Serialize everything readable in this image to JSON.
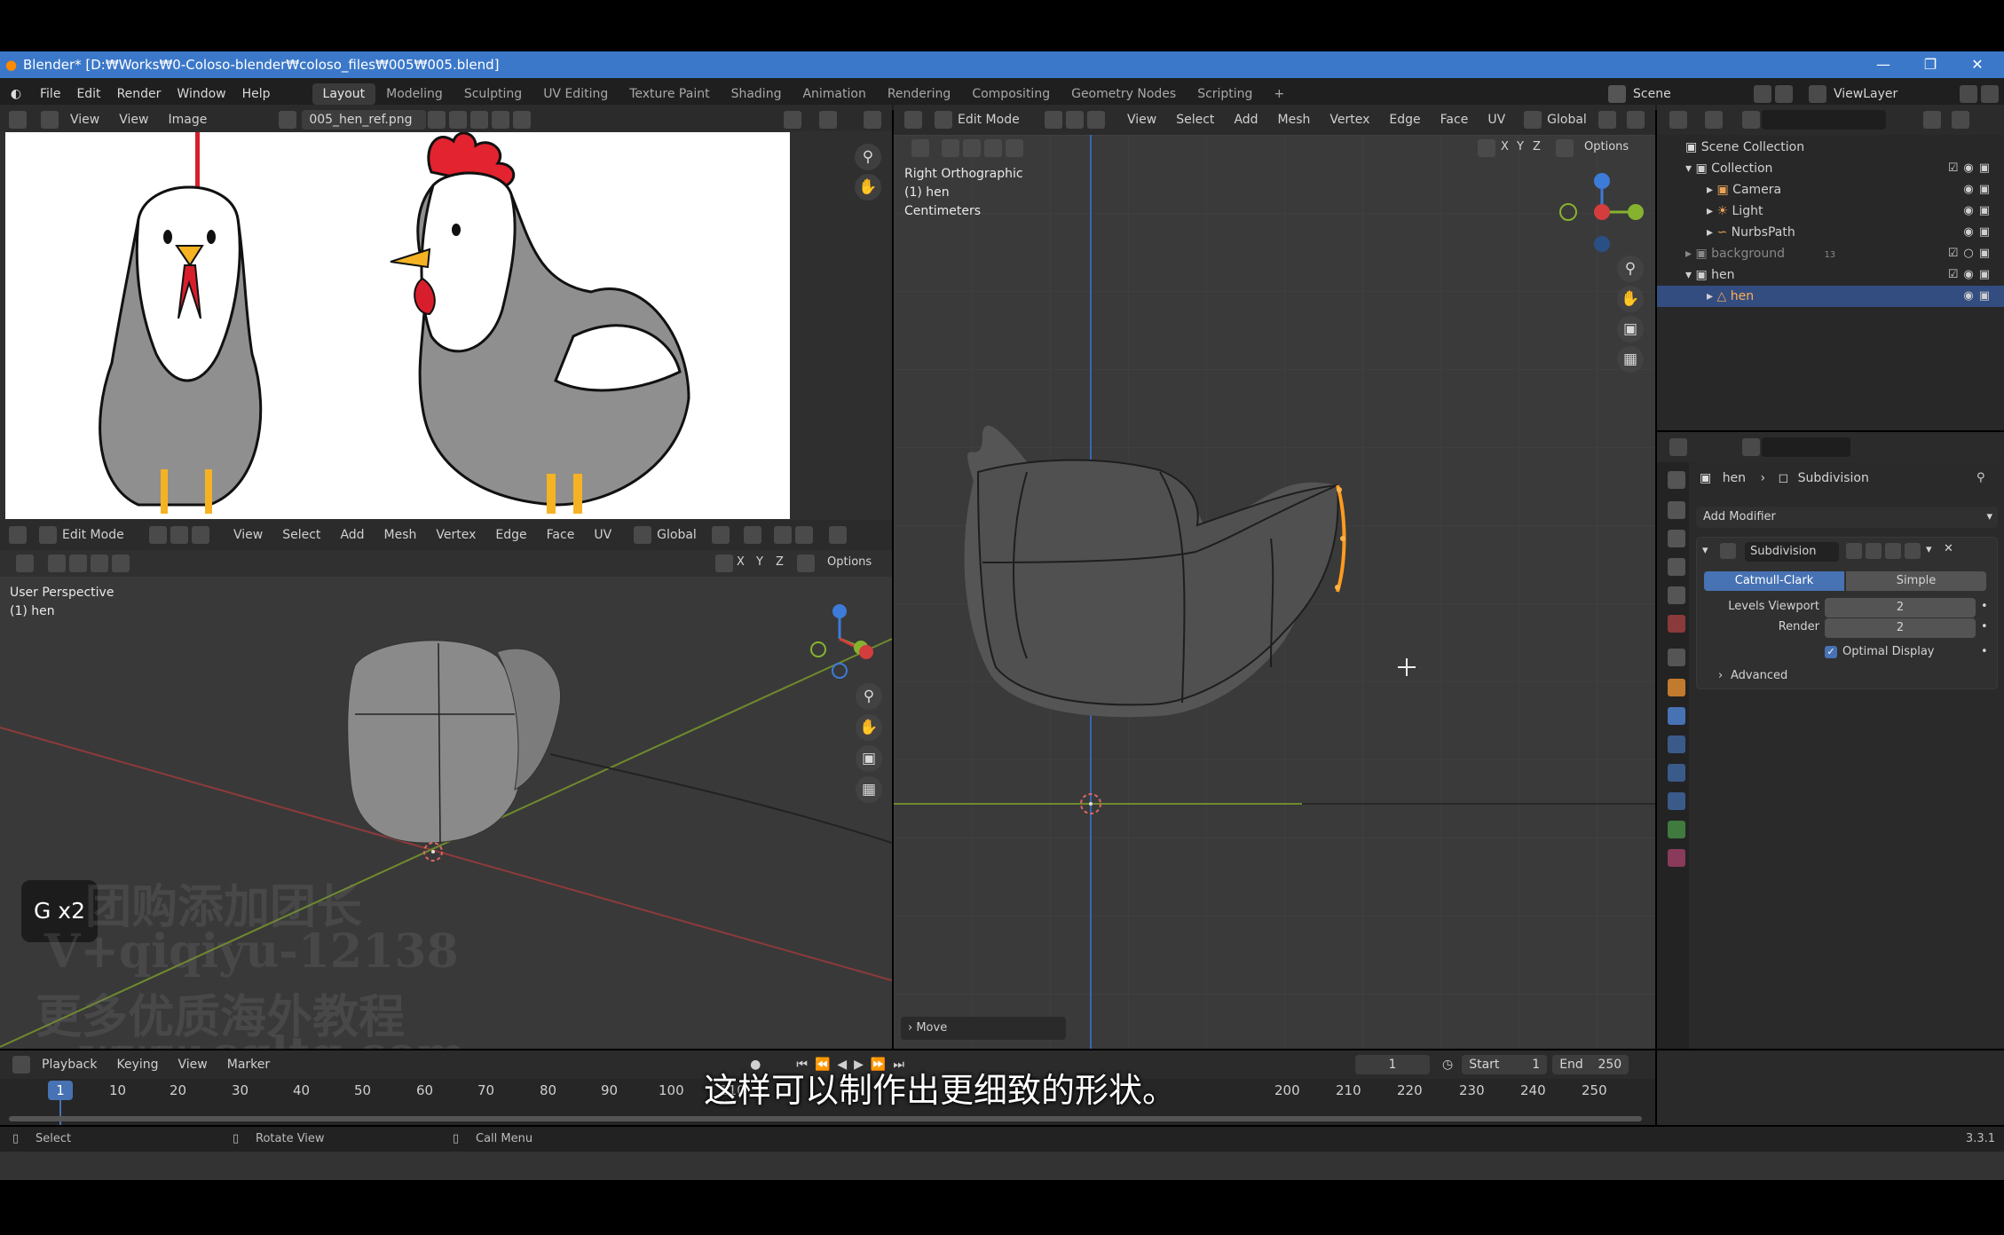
{
  "window": {
    "title": "Blender* [D:₩Works₩0-Coloso-blender₩coloso_files₩005₩005.blend]"
  },
  "menu": [
    "File",
    "Edit",
    "Render",
    "Window",
    "Help"
  ],
  "workspaces": [
    "Layout",
    "Modeling",
    "Sculpting",
    "UV Editing",
    "Texture Paint",
    "Shading",
    "Animation",
    "Rendering",
    "Compositing",
    "Geometry Nodes",
    "Scripting",
    "+"
  ],
  "scene": {
    "label": "Scene",
    "view_layer": "ViewLayer"
  },
  "image_editor": {
    "menus": [
      "View",
      "View",
      "Image"
    ],
    "image_name": "005_hen_ref.png"
  },
  "viewport_left": {
    "mode": "Edit Mode",
    "menus": [
      "View",
      "Select",
      "Add",
      "Mesh",
      "Vertex",
      "Edge",
      "Face",
      "UV"
    ],
    "orientation": "Global",
    "options": "Options",
    "overlay_lines": [
      "User Perspective",
      "(1) hen"
    ],
    "axes": [
      "X",
      "Y",
      "Z"
    ]
  },
  "viewport_right": {
    "mode": "Edit Mode",
    "menus": [
      "View",
      "Select",
      "Add",
      "Mesh",
      "Vertex",
      "Edge",
      "Face",
      "UV"
    ],
    "orientation": "Global",
    "options": "Options",
    "overlay_lines": [
      "Right Orthographic",
      "(1) hen",
      "Centimeters"
    ],
    "axes": [
      "X",
      "Y",
      "Z"
    ],
    "last_op": "Move"
  },
  "key_overlay": "G x2",
  "watermark": [
    "团购添加团长",
    "V+qiqiyu-12138",
    "更多优质海外教程",
    "www.cgltg.com"
  ],
  "outliner": {
    "rows": [
      {
        "label": "Scene Collection",
        "indent": 0
      },
      {
        "label": "Collection",
        "indent": 1
      },
      {
        "label": "Camera",
        "indent": 2
      },
      {
        "label": "Light",
        "indent": 2
      },
      {
        "label": "NurbsPath",
        "indent": 2
      },
      {
        "label": "background",
        "indent": 1
      },
      {
        "label": "hen",
        "indent": 1
      },
      {
        "label": "hen",
        "indent": 2,
        "selected": true
      }
    ],
    "background_badge": "13"
  },
  "properties": {
    "breadcrumb": [
      "hen",
      "Subdivision"
    ],
    "add_modifier": "Add Modifier",
    "modifier_name": "Subdivision",
    "subdiv_types": [
      "Catmull-Clark",
      "Simple"
    ],
    "active_type": "Catmull-Clark",
    "fields": [
      {
        "label": "Levels Viewport",
        "value": "2"
      },
      {
        "label": "Render",
        "value": "2"
      }
    ],
    "optimal_display": "Optimal Display",
    "optimal_display_checked": true,
    "advanced": "Advanced"
  },
  "timeline": {
    "menus": [
      "Playback",
      "Keying",
      "View",
      "Marker"
    ],
    "current_frame": "1",
    "start_label": "Start",
    "start": "1",
    "end_label": "End",
    "end": "250",
    "ticks": [
      "1",
      "10",
      "20",
      "30",
      "40",
      "50",
      "60",
      "70",
      "80",
      "90",
      "100",
      "110",
      "200",
      "210",
      "220",
      "230",
      "240",
      "250"
    ]
  },
  "subtitle": "这样可以制作出更细致的形状。",
  "statusbar": {
    "items": [
      "Select",
      "Rotate View",
      "Call Menu"
    ],
    "version": "3.3.1"
  },
  "colors": {
    "accent": "#4772b3",
    "titlebar": "#3b78c9",
    "selected_edge": "#ff9b1f"
  }
}
